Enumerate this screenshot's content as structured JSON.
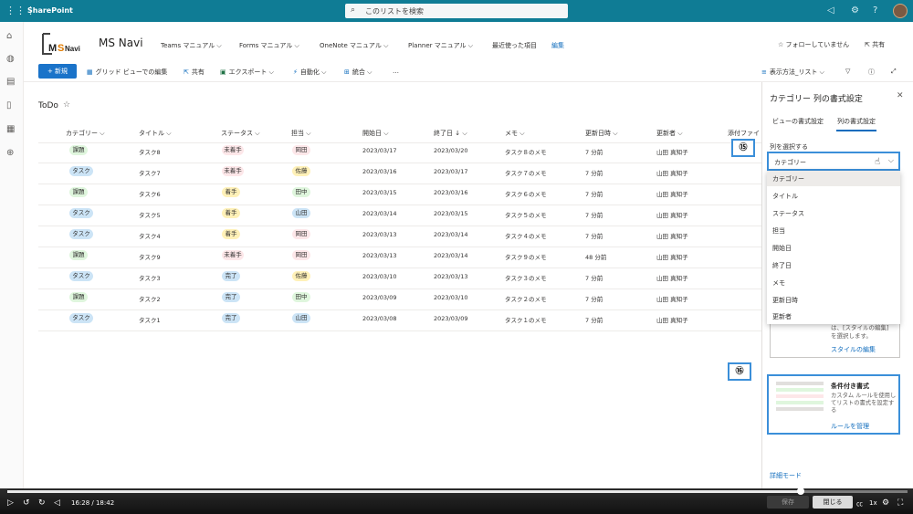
{
  "topbar": {
    "brand": "SharePoint",
    "search_placeholder": "このリストを検索"
  },
  "site": {
    "name": "MS Navi",
    "logo_text": "MSNavi",
    "nav": [
      "Teams マニュアル ⌵",
      "Forms マニュアル ⌵",
      "OneNote マニュアル ⌵",
      "Planner マニュアル ⌵",
      "最近使った項目"
    ],
    "edit": "編集",
    "follow": "☆ フォローしていません",
    "share": "共有"
  },
  "commands": {
    "new": "+ 新規",
    "grid": "グリッド ビューでの編集",
    "share": "共有",
    "export": "エクスポート ⌵",
    "automate": "自動化 ⌵",
    "integrate": "統合 ⌵",
    "more": "…",
    "view": "表示方法_リスト ⌵"
  },
  "list": {
    "title": "ToDo",
    "headers": [
      "カテゴリー ⌵",
      "タイトル ⌵",
      "ステータス ⌵",
      "担当 ⌵",
      "開始日 ⌵",
      "終了日 ↓ ⌵",
      "メモ ⌵",
      "更新日時 ⌵",
      "更新者 ⌵",
      "添付ファイ"
    ],
    "rows": [
      {
        "cat": "課題",
        "title": "タスク8",
        "status": "未着手",
        "owner": "岡田",
        "start": "2023/03/17",
        "end": "2023/03/20",
        "memo": "タスク８のメモ",
        "mod": "7 分前",
        "by": "山田 真知子"
      },
      {
        "cat": "タスク",
        "title": "タスク7",
        "status": "未着手",
        "owner": "佐藤",
        "start": "2023/03/16",
        "end": "2023/03/17",
        "memo": "タスク７のメモ",
        "mod": "7 分前",
        "by": "山田 真知子"
      },
      {
        "cat": "課題",
        "title": "タスク6",
        "status": "着手",
        "owner": "田中",
        "start": "2023/03/15",
        "end": "2023/03/16",
        "memo": "タスク６のメモ",
        "mod": "7 分前",
        "by": "山田 真知子"
      },
      {
        "cat": "タスク",
        "title": "タスク5",
        "status": "着手",
        "owner": "山田",
        "start": "2023/03/14",
        "end": "2023/03/15",
        "memo": "タスク５のメモ",
        "mod": "7 分前",
        "by": "山田 真知子"
      },
      {
        "cat": "タスク",
        "title": "タスク4",
        "status": "着手",
        "owner": "岡田",
        "start": "2023/03/13",
        "end": "2023/03/14",
        "memo": "タスク４のメモ",
        "mod": "7 分前",
        "by": "山田 真知子"
      },
      {
        "cat": "課題",
        "title": "タスク9",
        "status": "未着手",
        "owner": "岡田",
        "start": "2023/03/13",
        "end": "2023/03/14",
        "memo": "タスク９のメモ",
        "mod": "48 分前",
        "by": "山田 真知子"
      },
      {
        "cat": "タスク",
        "title": "タスク3",
        "status": "完了",
        "owner": "佐藤",
        "start": "2023/03/10",
        "end": "2023/03/13",
        "memo": "タスク３のメモ",
        "mod": "7 分前",
        "by": "山田 真知子"
      },
      {
        "cat": "課題",
        "title": "タスク2",
        "status": "完了",
        "owner": "田中",
        "start": "2023/03/09",
        "end": "2023/03/10",
        "memo": "タスク２のメモ",
        "mod": "7 分前",
        "by": "山田 真知子"
      },
      {
        "cat": "タスク",
        "title": "タスク1",
        "status": "完了",
        "owner": "山田",
        "start": "2023/03/08",
        "end": "2023/03/09",
        "memo": "タスク１のメモ",
        "mod": "7 分前",
        "by": "山田 真知子"
      }
    ]
  },
  "colors": {
    "cat": {
      "課題": "#dff6dd",
      "タスク": "#cce4f6"
    },
    "status": {
      "未着手": "#fde7e9",
      "着手": "#fff1b8",
      "完了": "#cce4f6"
    },
    "owner": {
      "岡田": "#fde7e9",
      "佐藤": "#fff1b8",
      "田中": "#dff6dd",
      "山田": "#cce4f6"
    }
  },
  "panel": {
    "title": "カテゴリー 列の書式設定",
    "tab_view": "ビューの書式設定",
    "tab_column": "列の書式設定",
    "select_label": "列を選択する",
    "selected": "カテゴリー",
    "options": [
      "カテゴリー",
      "タイトル",
      "ステータス",
      "担当",
      "開始日",
      "終了日",
      "メモ",
      "更新日時",
      "更新者"
    ],
    "style_text": "は、[スタイルの編集] を選択します。",
    "style_link": "スタイルの編集",
    "cond_title": "条件付き書式",
    "cond_desc": "カスタム ルールを使用してリストの書式を設定する",
    "cond_link": "ルールを管理",
    "advanced": "詳細モード",
    "save": "保存",
    "close": "閉じる"
  },
  "callouts": {
    "c15": "⑮",
    "c16": "⑯"
  },
  "player": {
    "time": "16:28 / 18:42",
    "speed": "1x"
  }
}
